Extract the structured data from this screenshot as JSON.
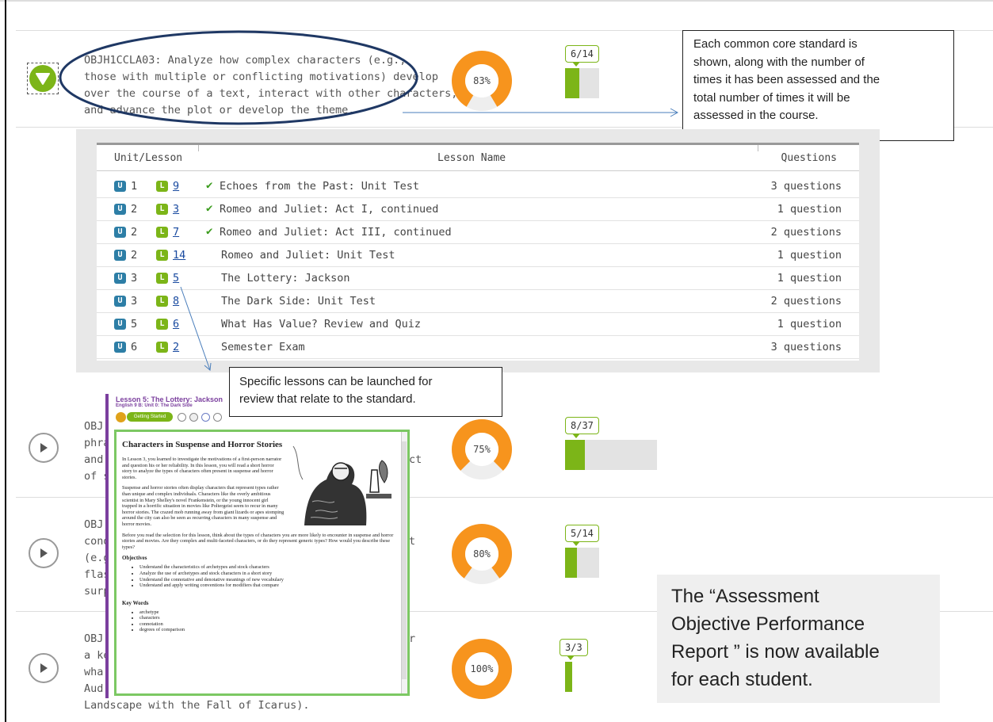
{
  "objectives": [
    {
      "lines": [
        "OBJH1CCLA03: Analyze how complex characters (e.g.,",
        "those with multiple or conflicting motivations) develop",
        "over the course of a text, interact with other characters,",
        "and advance the plot or develop the theme."
      ],
      "percent": 0.83,
      "percent_label": "83%",
      "assessed": 6,
      "total": 14,
      "fraction_label": "6/14",
      "expanded": true
    },
    {
      "lines": [
        "OBJ",
        "phra",
        "and",
        "of sp"
      ],
      "trailing_text": [
        "",
        "",
        "ct",
        ""
      ],
      "percent": 0.75,
      "percent_label": "75%",
      "assessed": 8,
      "total": 37,
      "fraction_label": "8/37",
      "expanded": false
    },
    {
      "lines": [
        "OBJ",
        "cond",
        "(e.g.",
        "flash",
        "surp"
      ],
      "trailing_text": [
        "",
        "t",
        "",
        "",
        ""
      ],
      "percent": 0.8,
      "percent_label": "80%",
      "assessed": 5,
      "total": 14,
      "fraction_label": "5/14",
      "expanded": false
    },
    {
      "lines": [
        "OBJ",
        "a ke",
        "wha",
        "Aud",
        "Landscape with the Fall of Icarus)."
      ],
      "trailing_text": [
        "r",
        "",
        "",
        "",
        ""
      ],
      "percent": 1.0,
      "percent_label": "100%",
      "assessed": 3,
      "total": 3,
      "fraction_label": "3/3",
      "expanded": false
    }
  ],
  "lesson_table": {
    "headers": {
      "unit_lesson": "Unit/Lesson",
      "lesson_name": "Lesson Name",
      "questions": "Questions"
    },
    "badge_u": "U",
    "badge_l": "L",
    "check_glyph": "✔",
    "rows": [
      {
        "unit": "1",
        "lesson": "9",
        "name": "Echoes from the Past: Unit Test",
        "questions": "3 questions",
        "completed": true
      },
      {
        "unit": "2",
        "lesson": "3",
        "name": "Romeo and Juliet: Act I, continued",
        "questions": "1 question",
        "completed": true
      },
      {
        "unit": "2",
        "lesson": "7",
        "name": "Romeo and Juliet: Act III, continued",
        "questions": "2 questions",
        "completed": true
      },
      {
        "unit": "2",
        "lesson": "14",
        "name": "Romeo and Juliet: Unit Test",
        "questions": "1 question",
        "completed": false
      },
      {
        "unit": "3",
        "lesson": "5",
        "name": "The Lottery: Jackson",
        "questions": "1 question",
        "completed": false
      },
      {
        "unit": "3",
        "lesson": "8",
        "name": "The Dark Side: Unit Test",
        "questions": "2 questions",
        "completed": false
      },
      {
        "unit": "5",
        "lesson": "6",
        "name": "What Has Value? Review and Quiz",
        "questions": "1 question",
        "completed": false
      },
      {
        "unit": "6",
        "lesson": "2",
        "name": "Semester Exam",
        "questions": "3 questions",
        "completed": false
      }
    ]
  },
  "callouts": {
    "standard_note": [
      "Each common core standard  is",
      "shown, along with the number of",
      "times it has been assessed and the",
      "total number of times it will be",
      "assessed in the course."
    ],
    "lesson_note": [
      "Specific lessons can be launched for",
      "review that relate to the standard."
    ],
    "report_note": [
      "The “Assessment",
      "Objective Performance",
      "Report ” is now available",
      "for each student."
    ]
  },
  "lesson_popup": {
    "title": "Lesson 5: The Lottery: Jackson",
    "subtitle": "English 9 B: Unit 0: The Dark Side",
    "tab_label": "Getting Started",
    "doc_title": "Characters in Suspense and Horror Stories",
    "para1": "In Lesson 3, you learned to investigate the motivations of a first-person narrator and question his or her reliability. In this lesson, you will read a short horror story to analyze the types of characters often present in suspense and horror stories.",
    "para2": "Suspense and horror stories often display characters that represent types rather than unique and complex individuals. Characters like the overly ambitious scientist in Mary Shelley's novel Frankenstein, or the young innocent girl trapped in a horrific situation in movies like Poltergeist seem to recur in many horror stories. The crazed mob running away from giant lizards or apes stomping around the city can also be seen as recurring characters in many suspense and horror movies.",
    "para3": "Before you read the selection for this lesson, think about the types of characters you are more likely to encounter in suspense and horror stories and movies. Are they complex and multi-faceted characters, or do they represent generic types? How would you describe these types?",
    "objectives_heading": "Objectives",
    "objectives": [
      "Understand the characteristics of archetypes and stock characters",
      "Analyze the use of archetypes and stock characters in a short story",
      "Understand the connotative and denotative meanings of new vocabulary",
      "Understand and apply writing conventions for modifiers that compare"
    ],
    "keywords_heading": "Key Words",
    "keywords": [
      "archetype",
      "characters",
      "connotation",
      "degrees of comparison"
    ]
  },
  "colors": {
    "accent_green": "#7cb518",
    "gauge_orange": "#f7941d",
    "unit_badge_blue": "#2d7ea6",
    "ellipse_navy": "#1f3864",
    "popup_purple": "#7b3f9e",
    "link_blue": "#1a4ba0"
  },
  "icons": {
    "expanded_toggle": "chevron-down-icon",
    "collapsed_toggle": "play-icon",
    "completed": "checkmark-icon"
  }
}
